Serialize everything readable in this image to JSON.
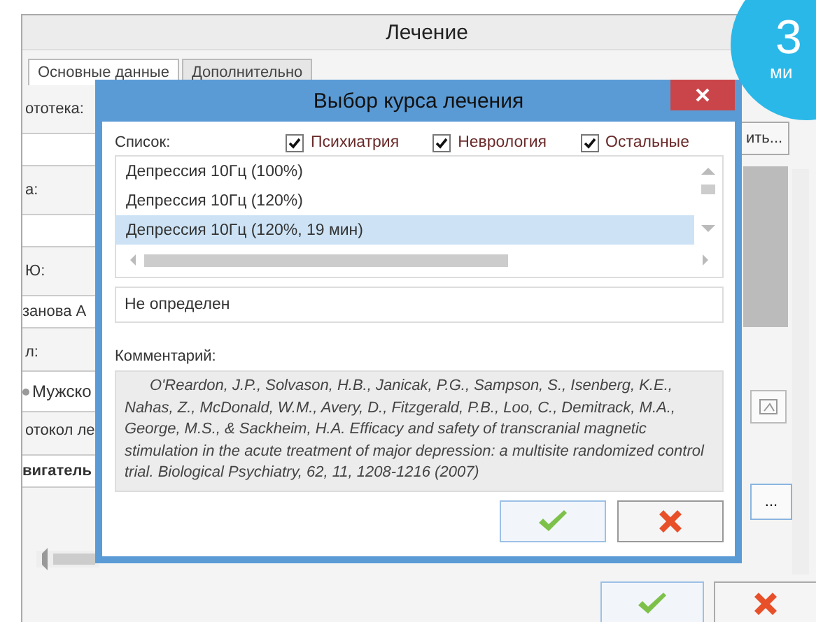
{
  "window": {
    "title": "Лечение",
    "tabs": [
      {
        "label": "Основные данные",
        "selected": true
      },
      {
        "label": "Дополнительно",
        "selected": false
      }
    ],
    "left_strip": [
      {
        "kind": "label",
        "text": "ототека:"
      },
      {
        "kind": "field"
      },
      {
        "kind": "label",
        "text": "а:"
      },
      {
        "kind": "field"
      },
      {
        "kind": "label",
        "text": "Ю:"
      },
      {
        "kind": "field",
        "text": "занова А"
      },
      {
        "kind": "label",
        "text": "л:"
      },
      {
        "kind": "radio",
        "text": "Мужско"
      },
      {
        "kind": "label",
        "text": "отокол ле"
      },
      {
        "kind": "strong-field",
        "text": "вигатель"
      }
    ],
    "browse_button": "ить...",
    "ellipsis_button": "..."
  },
  "dialog": {
    "title": "Выбор курса лечения",
    "list_label": "Список:",
    "filters": [
      {
        "label": "Психиатрия",
        "checked": true
      },
      {
        "label": "Неврология",
        "checked": true
      },
      {
        "label": "Остальные",
        "checked": true
      }
    ],
    "courses": [
      {
        "label": "Депрессия 10Гц (100%)",
        "selected": false
      },
      {
        "label": "Депрессия 10Гц (120%)",
        "selected": false
      },
      {
        "label": "Депрессия 10Гц (120%, 19 мин)",
        "selected": true
      }
    ],
    "protocol": "Не определен",
    "comment_label": "Комментарий:",
    "comment": "O'Reardon, J.P., Solvason, H.B., Janicak, P.G., Sampson, S., Isenberg, K.E., Nahas, Z., McDonald, W.M., Avery, D., Fitzgerald, P.B., Loo, C., Demitrack, M.A., George, M.S., & Sackheim, H.A. Efficacy and safety of transcranial magnetic stimulation in the acute treatment of major depression: a multisite randomized control trial. Biological Psychiatry, 62, 11, 1208-1216 (2007)"
  },
  "badge": {
    "number": "3",
    "text": "ми"
  }
}
